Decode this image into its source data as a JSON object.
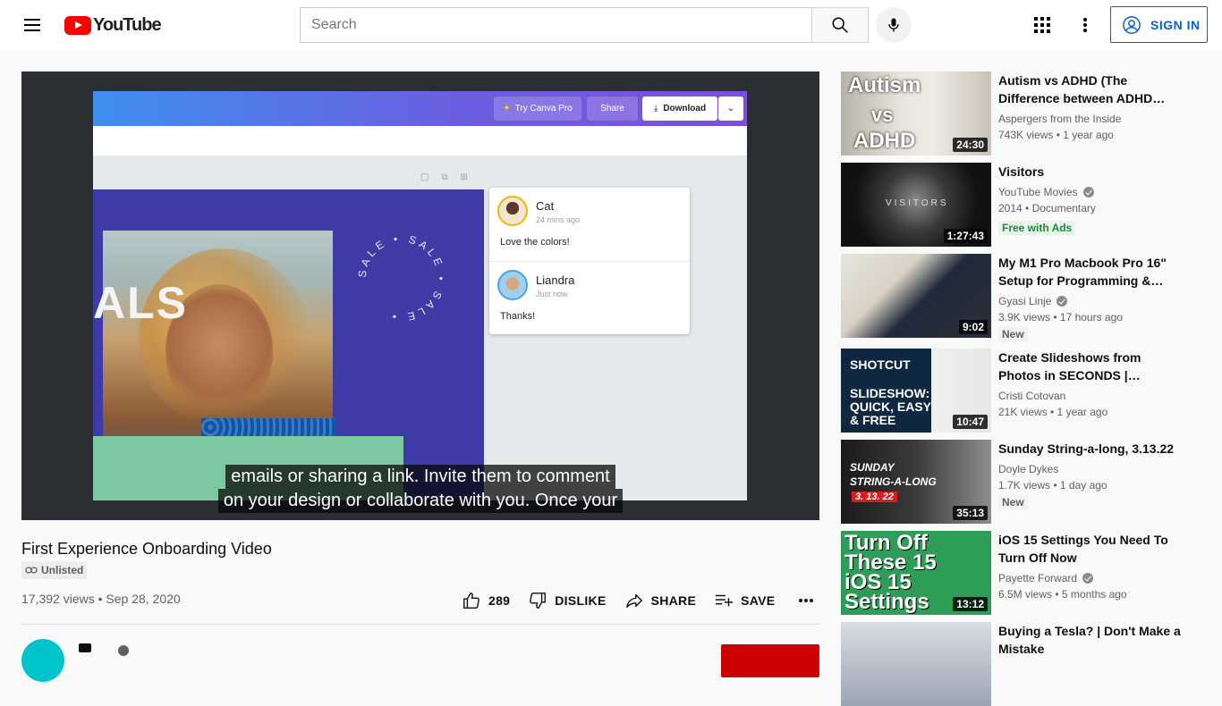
{
  "header": {
    "logo_text": "YouTube",
    "search_placeholder": "Search",
    "signin_label": "SIGN IN"
  },
  "player": {
    "canva": {
      "try_pro": "Try Canva Pro",
      "share": "Share",
      "download": "Download",
      "design_text": "ALS",
      "comments": [
        {
          "name": "Cat",
          "time": "24 mins ago",
          "text": "Love the colors!"
        },
        {
          "name": "Liandra",
          "time": "Just now",
          "text": "Thanks!"
        }
      ]
    },
    "captions": [
      "emails or sharing a link. Invite them to comment",
      "on your design or collaborate with you. Once your"
    ]
  },
  "video": {
    "title": "First Experience Onboarding Video",
    "visibility": "Unlisted",
    "views_date": "17,392 views • Sep 28, 2020",
    "like_count": "289",
    "dislike_label": "DISLIKE",
    "share_label": "SHARE",
    "save_label": "SAVE"
  },
  "recommendations": [
    {
      "title": "Autism vs ADHD (The Difference between ADHD and…",
      "channel": "Aspergers from the Inside",
      "verified": false,
      "meta": "743K views • 1 year ago",
      "badge": "",
      "duration": "24:30",
      "thumb_text": [
        "Autism",
        "vs",
        "ADHD"
      ]
    },
    {
      "title": "Visitors",
      "channel": "YouTube Movies",
      "verified": true,
      "meta": "2014 • Documentary",
      "badge": "Free with Ads",
      "duration": "1:27:43",
      "thumb_text": [
        "VISITORS"
      ]
    },
    {
      "title": "My M1 Pro Macbook Pro 16\" Setup for Programming &…",
      "channel": "Gyasi Linje",
      "verified": true,
      "meta": "3.9K views • 17 hours ago",
      "badge": "New",
      "duration": "9:02",
      "thumb_text": []
    },
    {
      "title": "Create Slideshows from Photos in SECONDS | Quickest, Easies…",
      "channel": "Cristi Cotovan",
      "verified": false,
      "meta": "21K views • 1 year ago",
      "badge": "",
      "duration": "10:47",
      "thumb_text": [
        "SHOTCUT",
        "SLIDESHOW:",
        "QUICK, EASY",
        "& FREE"
      ]
    },
    {
      "title": "Sunday String-a-long, 3.13.22",
      "channel": "Doyle Dykes",
      "verified": false,
      "meta": "1.7K views • 1 day ago",
      "badge": "New",
      "duration": "35:13",
      "thumb_text": [
        "SUNDAY",
        "STRING-A-LONG",
        "3. 13. 22"
      ]
    },
    {
      "title": "iOS 15 Settings You Need To Turn Off Now",
      "channel": "Payette Forward",
      "verified": true,
      "meta": "6.5M views • 5 months ago",
      "badge": "",
      "duration": "13:12",
      "thumb_text": [
        "Turn Off",
        "These 15",
        "iOS 15",
        "Settings"
      ]
    },
    {
      "title": "Buying a Tesla? | Don't Make a Mistake",
      "channel": "",
      "verified": false,
      "meta": "",
      "badge": "",
      "duration": "",
      "thumb_text": []
    }
  ],
  "colors": {
    "brand_red": "#ff0000",
    "link_blue": "#065fd4",
    "free_green": "#1b8a3a"
  }
}
